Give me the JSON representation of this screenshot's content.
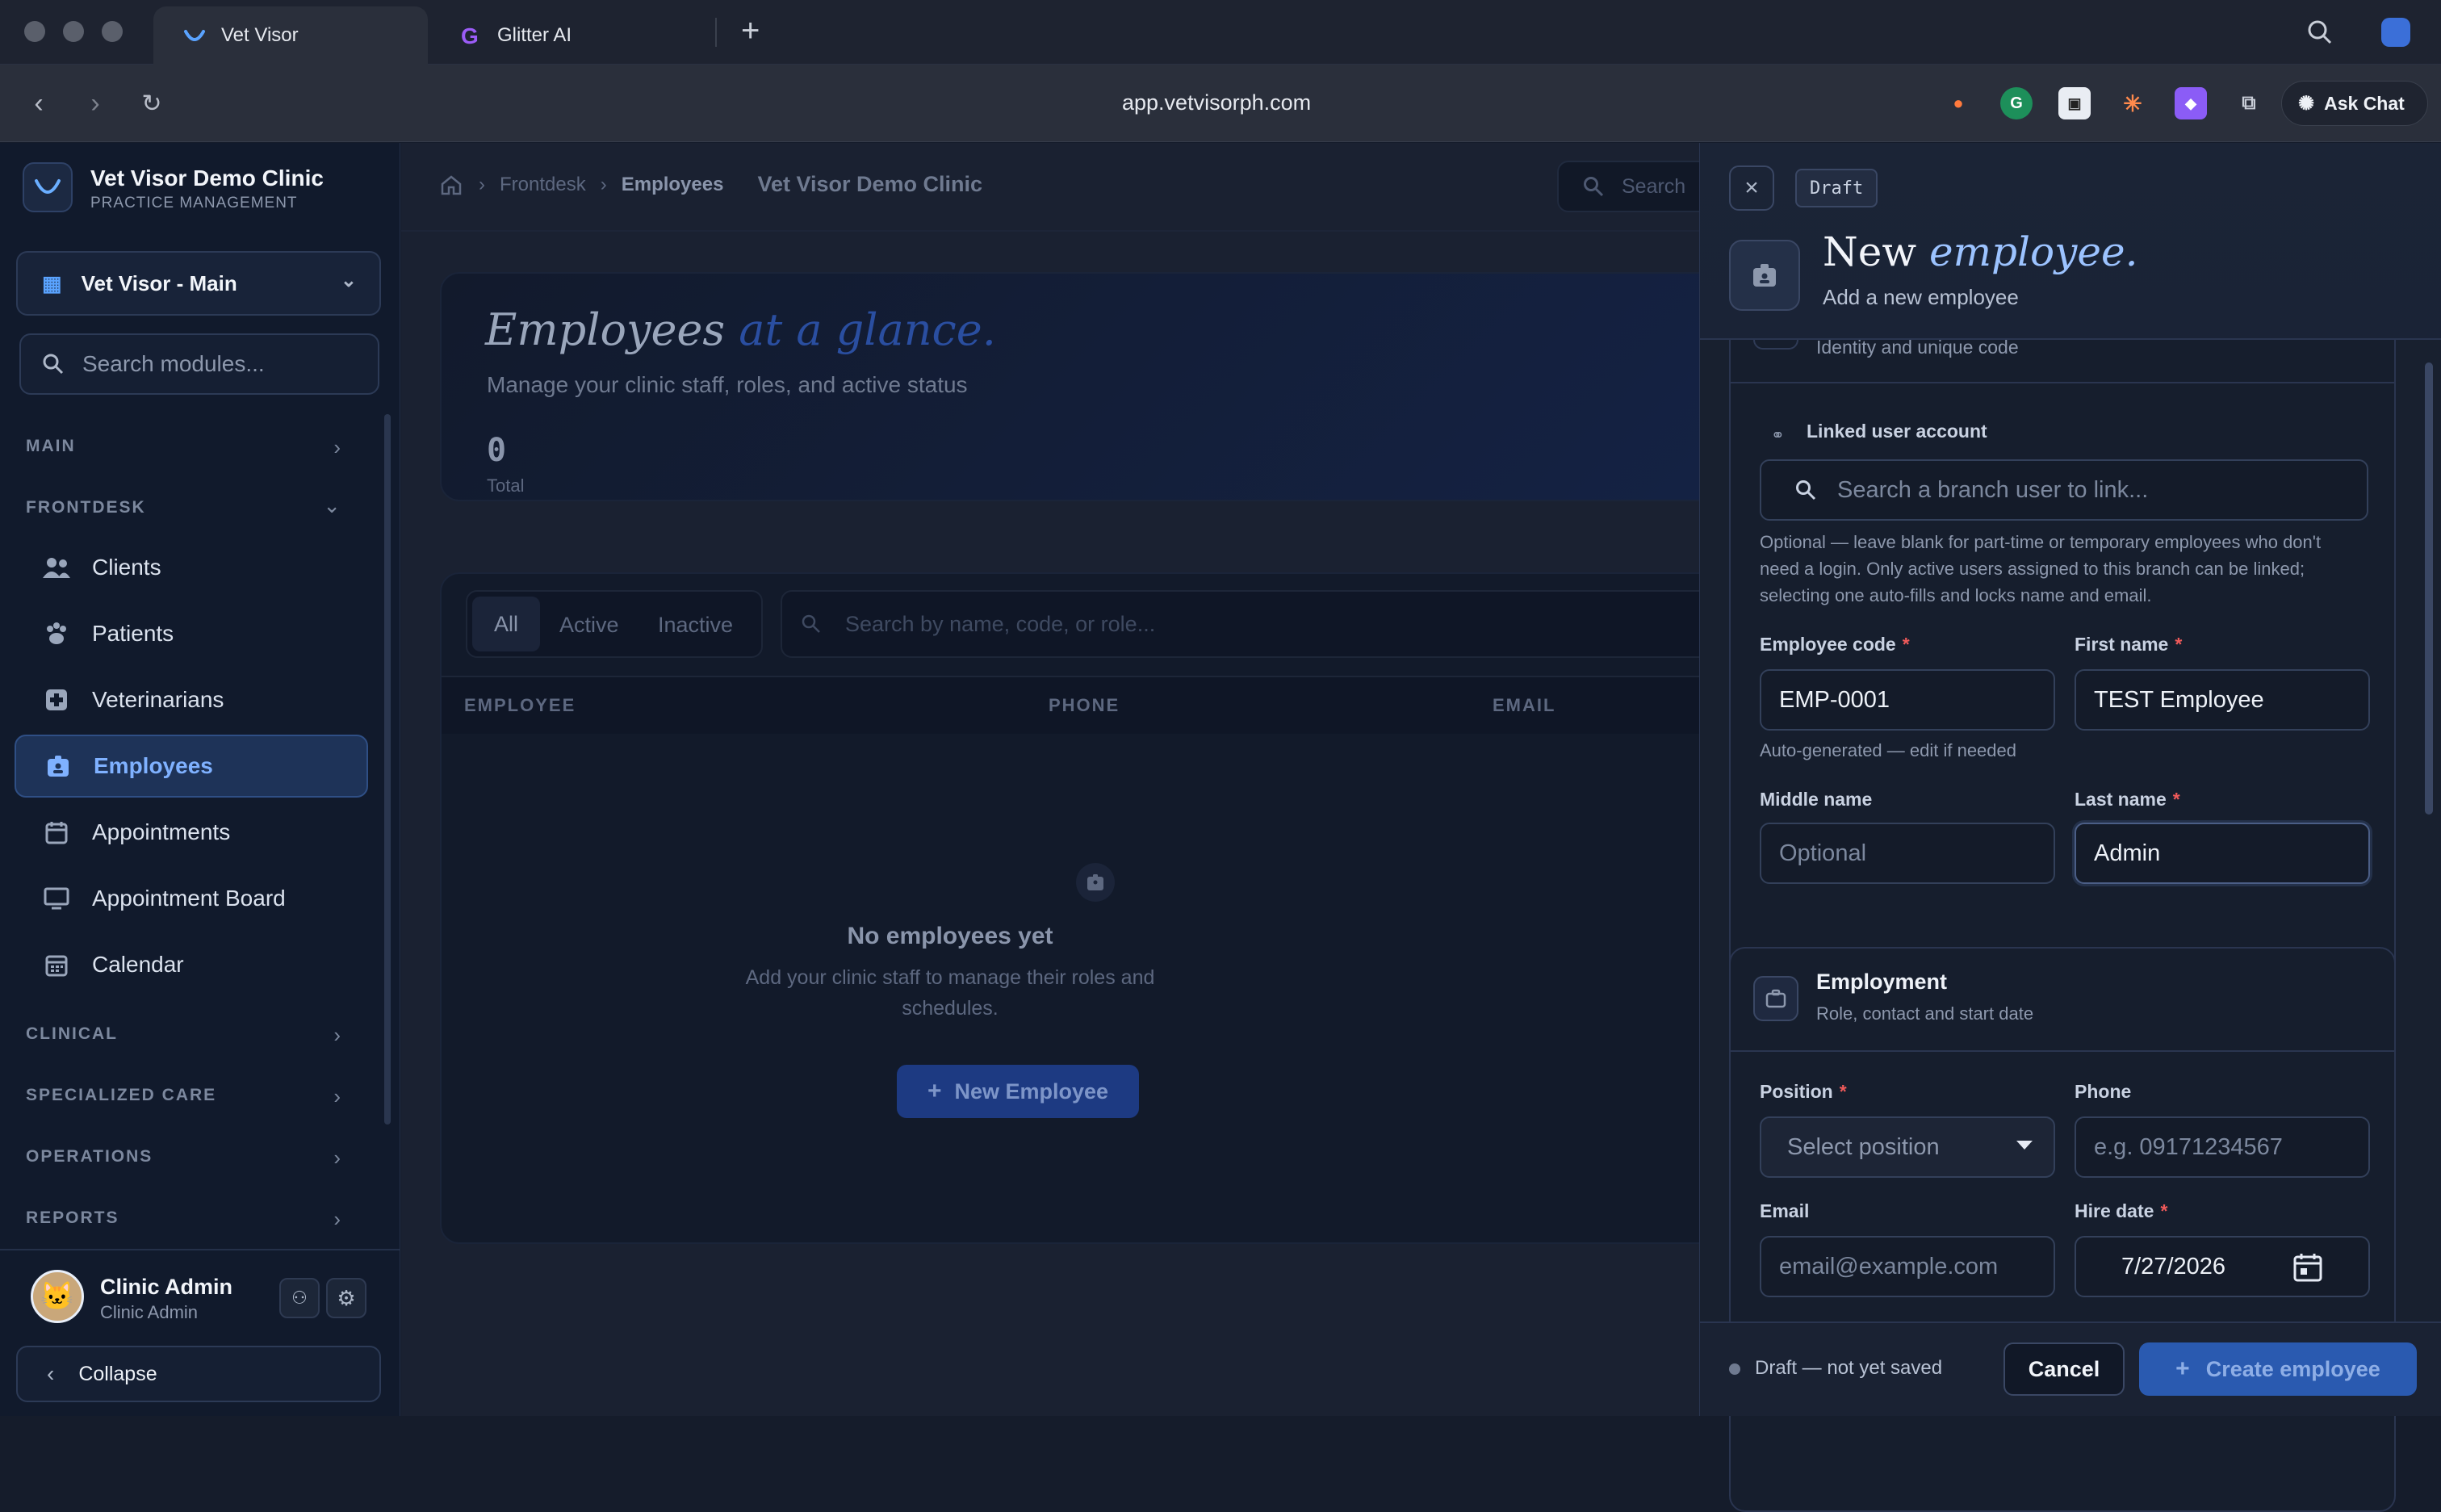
{
  "browser": {
    "tabs": [
      {
        "label": "Vet Visor"
      },
      {
        "label": "Glitter AI"
      }
    ],
    "new_tab": "+",
    "url": "app.vetvisorph.com",
    "ask_chat": "Ask Chat"
  },
  "sidebar": {
    "clinic_name": "Vet Visor Demo Clinic",
    "clinic_subtitle": "PRACTICE MANAGEMENT",
    "branch": "Vet Visor - Main",
    "search_placeholder": "Search modules...",
    "sections": {
      "main": "MAIN",
      "frontdesk": "FRONTDESK",
      "clinical": "CLINICAL",
      "specialized": "SPECIALIZED CARE",
      "operations": "OPERATIONS",
      "reports": "REPORTS"
    },
    "items": [
      {
        "label": "Clients",
        "icon": "users-icon"
      },
      {
        "label": "Patients",
        "icon": "paw-icon"
      },
      {
        "label": "Veterinarians",
        "icon": "medical-cross-icon"
      },
      {
        "label": "Employees",
        "icon": "badge-icon",
        "active": true
      },
      {
        "label": "Appointments",
        "icon": "calendar-icon"
      },
      {
        "label": "Appointment Board",
        "icon": "monitor-icon"
      },
      {
        "label": "Calendar",
        "icon": "calendar-grid-icon"
      }
    ],
    "user": {
      "name": "Clinic Admin",
      "role": "Clinic Admin"
    },
    "collapse": "Collapse"
  },
  "main": {
    "breadcrumb": {
      "section": "Frontdesk",
      "page": "Employees",
      "clinic": "Vet Visor Demo Clinic"
    },
    "search_placeholder": "Search",
    "hero": {
      "title": "Employees",
      "title_accent": "at a glance.",
      "subtitle": "Manage your clinic staff, roles, and active status",
      "total_value": "0",
      "total_label": "Total"
    },
    "filters": [
      "All",
      "Active",
      "Inactive"
    ],
    "table_search_placeholder": "Search by name, code, or role...",
    "columns": [
      "EMPLOYEE",
      "PHONE",
      "EMAIL"
    ],
    "empty": {
      "title": "No employees yet",
      "text_line1": "Add your clinic staff to manage their roles and",
      "text_line2": "schedules.",
      "button": "New Employee"
    }
  },
  "drawer": {
    "status_badge": "Draft",
    "title_plain": "New",
    "title_accent": "employee.",
    "subtitle": "Add a new employee",
    "identity_hint": "Identity and unique code",
    "linked_account": {
      "label": "Linked user account",
      "placeholder": "Search a branch user to link...",
      "help_line1": "Optional — leave blank for part-time or temporary employees who don't",
      "help_line2": "need a login. Only active users assigned to this branch can be linked;",
      "help_line3": "selecting one auto-fills and locks name and email."
    },
    "fields": {
      "employee_code": {
        "label": "Employee code",
        "value": "EMP-0001",
        "hint": "Auto-generated — edit if needed"
      },
      "first_name": {
        "label": "First name",
        "value": "TEST Employee"
      },
      "middle_name": {
        "label": "Middle name",
        "placeholder": "Optional"
      },
      "last_name": {
        "label": "Last name",
        "value": "Admin"
      }
    },
    "employment": {
      "title": "Employment",
      "subtitle": "Role, contact and start date",
      "position": {
        "label": "Position",
        "placeholder": "Select position"
      },
      "phone": {
        "label": "Phone",
        "placeholder": "e.g. 09171234567"
      },
      "email": {
        "label": "Email",
        "placeholder": "email@example.com"
      },
      "hire_date": {
        "label": "Hire date",
        "value": "7/27/2026"
      }
    },
    "footer": {
      "status": "Draft — not yet saved",
      "cancel": "Cancel",
      "create": "Create employee"
    }
  },
  "colors": {
    "accent": "#3b82f6",
    "active_nav": "#7fb1ff",
    "required": "#ef5a5a"
  }
}
